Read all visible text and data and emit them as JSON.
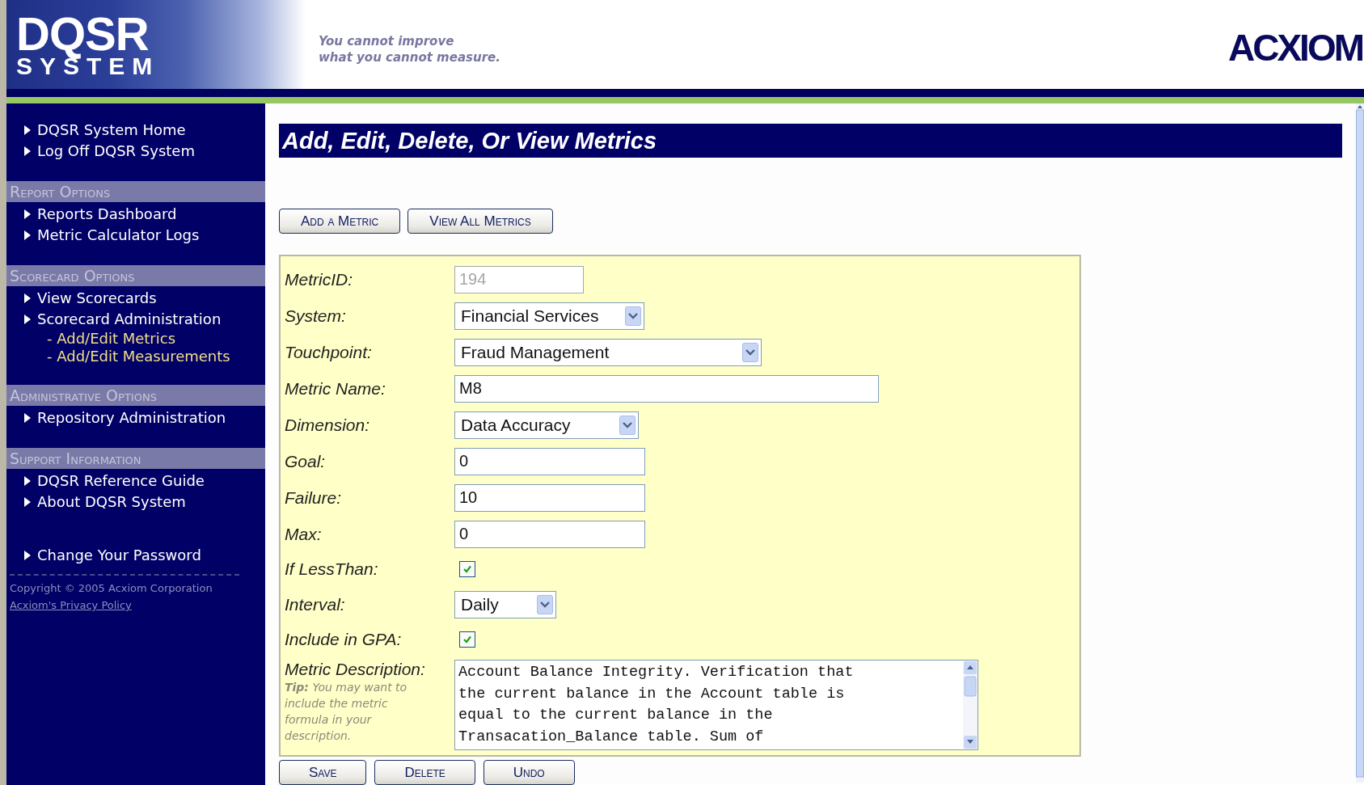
{
  "header": {
    "logo_title": "DQSR",
    "logo_subtitle": "SYSTEM",
    "tagline": [
      "You cannot improve",
      "what you cannot measure."
    ],
    "brand": "ACXIOM"
  },
  "sidebar": {
    "groups": [
      {
        "items": [
          {
            "kind": "link",
            "label": "DQSR System Home"
          },
          {
            "kind": "link",
            "label": "Log Off DQSR System"
          }
        ]
      },
      {
        "heading": "Report Options",
        "items": [
          {
            "kind": "link",
            "label": "Reports Dashboard"
          },
          {
            "kind": "link",
            "label": "Metric Calculator Logs"
          }
        ]
      },
      {
        "heading": "Scorecard Options",
        "items": [
          {
            "kind": "link",
            "label": "View Scorecards"
          },
          {
            "kind": "link",
            "label": "Scorecard Administration"
          },
          {
            "kind": "sublink",
            "label": "- Add/Edit Metrics"
          },
          {
            "kind": "sublink",
            "label": "- Add/Edit Measurements"
          }
        ]
      },
      {
        "heading": "Administrative Options",
        "items": [
          {
            "kind": "link",
            "label": "Repository Administration"
          }
        ]
      },
      {
        "heading": "Support Information",
        "items": [
          {
            "kind": "link",
            "label": "DQSR Reference Guide"
          },
          {
            "kind": "link",
            "label": "About DQSR System"
          }
        ]
      },
      {
        "items": [
          {
            "kind": "link",
            "label": "Change Your Password"
          }
        ]
      }
    ],
    "copyright": "Copyright © 2005 Acxiom Corporation",
    "privacy_link": "Acxiom's Privacy Policy"
  },
  "main": {
    "title": "Add, Edit, Delete, Or View Metrics",
    "top_buttons": [
      "Add a Metric",
      "View All Metrics"
    ],
    "fields": [
      {
        "kind": "text",
        "label": "MetricID:",
        "value": "194",
        "disabled": true
      },
      {
        "kind": "select",
        "label": "System:",
        "value": "Financial Services"
      },
      {
        "kind": "select",
        "label": "Touchpoint:",
        "value": "Fraud Management"
      },
      {
        "kind": "text",
        "label": "Metric Name:",
        "value": "M8",
        "disabled": false
      },
      {
        "kind": "select",
        "label": "Dimension:",
        "value": "Data Accuracy"
      },
      {
        "kind": "text",
        "label": "Goal:",
        "value": "0",
        "disabled": false
      },
      {
        "kind": "text",
        "label": "Failure:",
        "value": "10",
        "disabled": false
      },
      {
        "kind": "text",
        "label": "Max:",
        "value": "0",
        "disabled": false
      },
      {
        "kind": "checkbox",
        "label": "If LessThan:",
        "checked": true
      },
      {
        "kind": "select",
        "label": "Interval:",
        "value": "Daily"
      },
      {
        "kind": "checkbox",
        "label": "Include in GPA:",
        "checked": true
      },
      {
        "kind": "textarea",
        "label": "Metric Description:",
        "tip": "**Tip:** You may want to include the metric formula in your description.",
        "lines": [
          "Account Balance Integrity. Verification that",
          "the current balance in the Account table is",
          "equal to the current balance in the",
          "Transacation_Balance table. Sum of"
        ]
      }
    ],
    "bottom_buttons": [
      "Save",
      "Delete",
      "Undo"
    ]
  }
}
